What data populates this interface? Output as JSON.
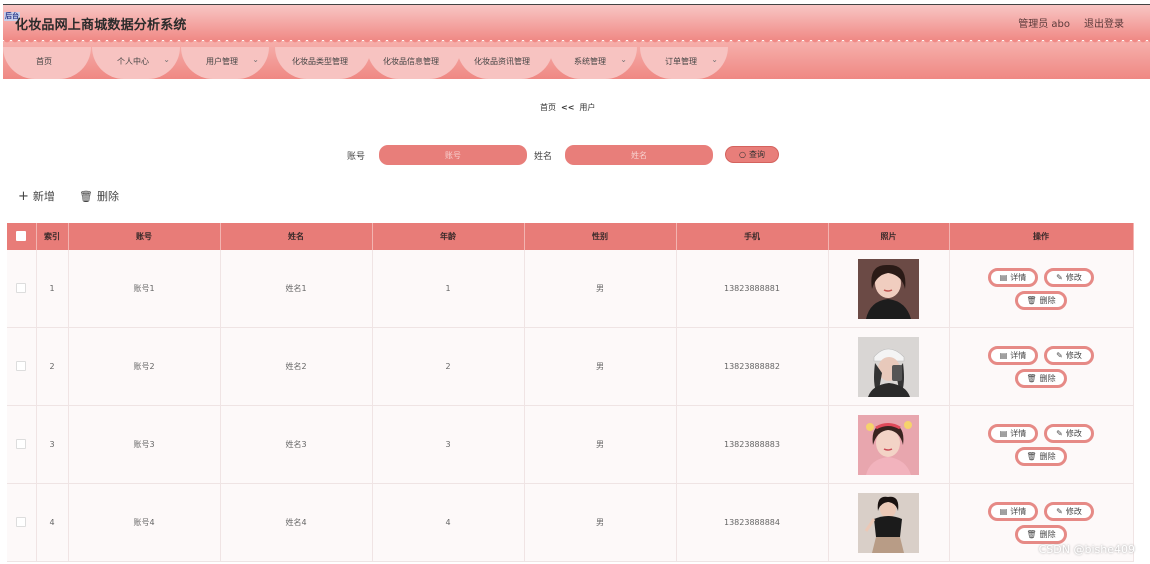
{
  "header": {
    "logo_badge": "后台",
    "title": "化妆品网上商城数据分析系统",
    "admin_label": "管理员 abo",
    "logout_label": "退出登录"
  },
  "nav": {
    "items": [
      {
        "label": "首页",
        "has_dropdown": false
      },
      {
        "label": "个人中心",
        "has_dropdown": true
      },
      {
        "label": "用户管理",
        "has_dropdown": true
      },
      {
        "label": "化妆品类型管理",
        "has_dropdown": false
      },
      {
        "label": "化妆品信息管理",
        "has_dropdown": false
      },
      {
        "label": "化妆品资讯管理",
        "has_dropdown": false
      },
      {
        "label": "系统管理",
        "has_dropdown": true
      },
      {
        "label": "订单管理",
        "has_dropdown": true
      }
    ]
  },
  "breadcrumb": {
    "home": "首页",
    "sep": "<<",
    "current": "用户"
  },
  "search": {
    "account_label": "账号",
    "account_placeholder": "账号",
    "name_label": "姓名",
    "name_placeholder": "姓名",
    "query_label": "查询"
  },
  "toolbar": {
    "add_label": "新增",
    "delete_label": "删除"
  },
  "table": {
    "columns": [
      "索引",
      "账号",
      "姓名",
      "年龄",
      "性别",
      "手机",
      "照片",
      "操作"
    ],
    "rows": [
      {
        "index": "1",
        "account": "账号1",
        "name": "姓名1",
        "age": "1",
        "gender": "男",
        "phone": "13823888881"
      },
      {
        "index": "2",
        "account": "账号2",
        "name": "姓名2",
        "age": "2",
        "gender": "男",
        "phone": "13823888882"
      },
      {
        "index": "3",
        "account": "账号3",
        "name": "姓名3",
        "age": "3",
        "gender": "男",
        "phone": "13823888883"
      },
      {
        "index": "4",
        "account": "账号4",
        "name": "姓名4",
        "age": "4",
        "gender": "男",
        "phone": "13823888884"
      }
    ],
    "actions": {
      "detail": "详情",
      "edit": "修改",
      "delete": "删除"
    }
  },
  "watermark": "CSDN @bishe409",
  "colors": {
    "accent": "#e87c78",
    "header_light": "#f8c6c4",
    "header_dark": "#f08a86"
  }
}
